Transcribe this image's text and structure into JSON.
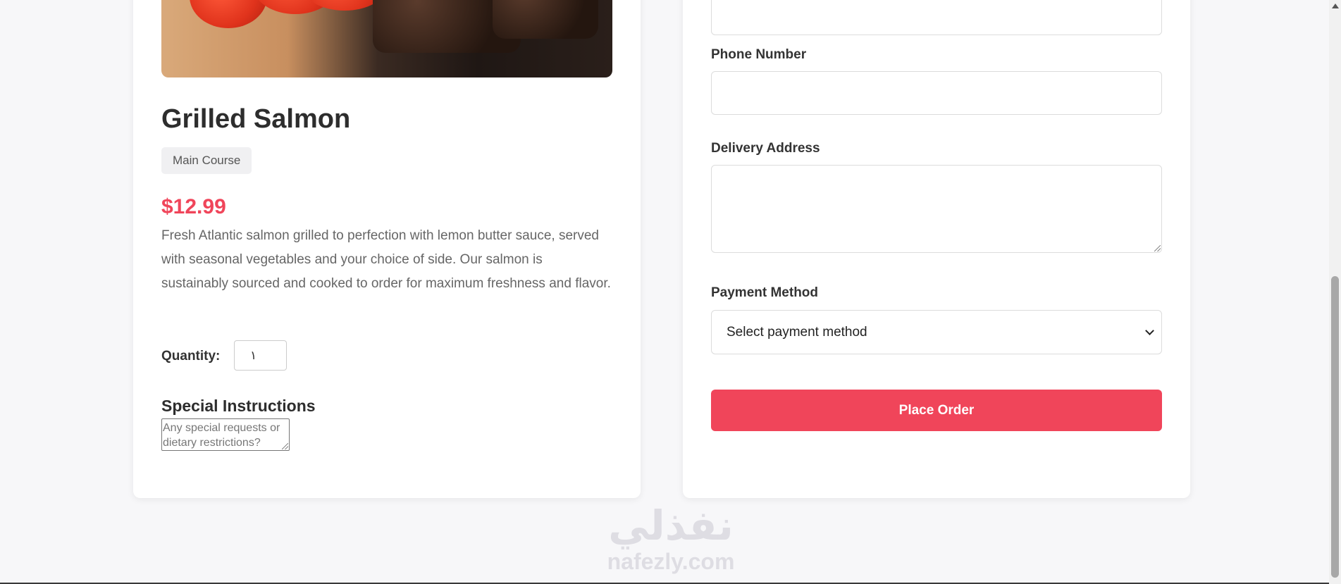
{
  "dish": {
    "name": "Grilled Salmon",
    "category": "Main Course",
    "price": "$12.99",
    "description": "Fresh Atlantic salmon grilled to perfection with lemon butter sauce, served with seasonal vegetables and your choice of side. Our salmon is sustainably sourced and cooked to order for maximum freshness and flavor."
  },
  "quantity": {
    "label": "Quantity:",
    "value": "١"
  },
  "special_instructions": {
    "title": "Special Instructions",
    "placeholder": "Any special requests or dietary restrictions?"
  },
  "order_form": {
    "phone_label": "Phone Number",
    "phone_value": "",
    "address_label": "Delivery Address",
    "address_value": "",
    "payment_label": "Payment Method",
    "payment_selected": "Select payment method",
    "submit_label": "Place Order"
  },
  "watermark": {
    "arabic": "نفذلي",
    "latin": "nafezly.com"
  },
  "colors": {
    "accent": "#f0455a",
    "page_background": "#f7f7f9",
    "card_background": "#ffffff"
  }
}
